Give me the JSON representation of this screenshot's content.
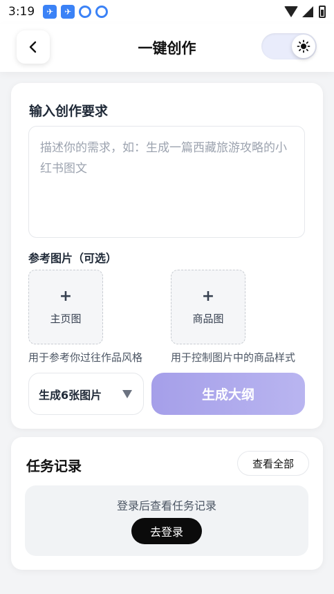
{
  "status_bar": {
    "time": "3:19"
  },
  "header": {
    "title": "一键创作"
  },
  "form": {
    "section_title": "输入创作要求",
    "request_placeholder": "描述你的需求，如：生成一篇西藏旅游攻略的小红书图文",
    "reference_label": "参考图片（可选）",
    "uploads": [
      {
        "label": "主页图",
        "hint": "用于参考你过往作品风格"
      },
      {
        "label": "商品图",
        "hint": "用于控制图片中的商品样式"
      }
    ],
    "plus_symbol": "+",
    "count_select": {
      "selected": "生成6张图片"
    },
    "generate_button": "生成大纲"
  },
  "tasks": {
    "title": "任务记录",
    "view_all": "查看全部",
    "empty_text": "登录后查看任务记录",
    "login_button": "去登录"
  },
  "colors": {
    "accent_start": "#a59fe9",
    "accent_end": "#b9b5f0",
    "login_button": "#0b0b0b"
  }
}
